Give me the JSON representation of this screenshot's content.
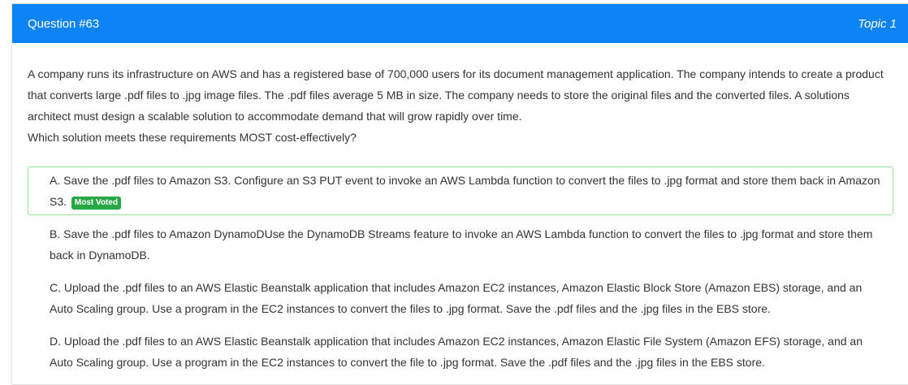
{
  "header": {
    "question_number": "Question #63",
    "topic": "Topic 1",
    "background_color": "#0d84f5"
  },
  "question": {
    "paragraph": "A company runs its infrastructure on AWS and has a registered base of 700,000 users for its document management application. The company intends to create a product that converts large .pdf files to .jpg image files. The .pdf files average 5 MB in size. The company needs to store the original files and the converted files. A solutions architect must design a scalable solution to accommodate demand that will grow rapidly over time.",
    "prompt": "Which solution meets these requirements MOST cost-effectively?"
  },
  "choices": [
    {
      "text": "A. Save the .pdf files to Amazon S3. Configure an S3 PUT event to invoke an AWS Lambda function to convert the files to .jpg format and store them back in Amazon S3.",
      "badge": "Most Voted"
    },
    {
      "text": "B. Save the .pdf files to Amazon DynamoDUse the DynamoDB Streams feature to invoke an AWS Lambda function to convert the files to .jpg format and store them back in DynamoDB."
    },
    {
      "text": "C. Upload the .pdf files to an AWS Elastic Beanstalk application that includes Amazon EC2 instances, Amazon Elastic Block Store (Amazon EBS) storage, and an Auto Scaling group. Use a program in the EC2 instances to convert the files to .jpg format. Save the .pdf files and the .jpg files in the EBS store."
    },
    {
      "text": "D. Upload the .pdf files to an AWS Elastic Beanstalk application that includes Amazon EC2 instances, Amazon Elastic File System (Amazon EFS) storage, and an Auto Scaling group. Use a program in the EC2 instances to convert the file to .jpg format. Save the .pdf files and the .jpg files in the EBS store."
    }
  ]
}
